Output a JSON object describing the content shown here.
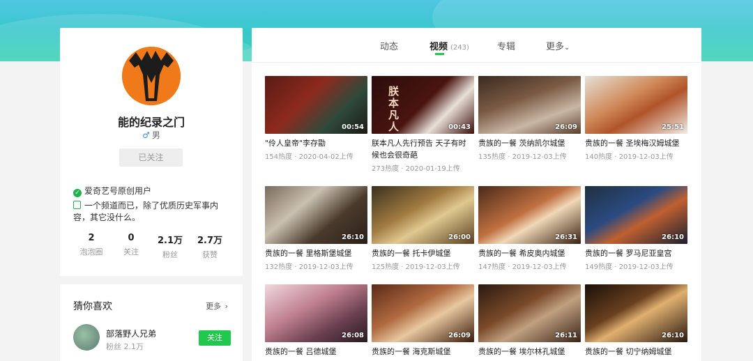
{
  "profile": {
    "name": "能的纪录之门",
    "gender_icon": "male-icon",
    "gender": "男",
    "follow_state": "已关注",
    "verified_text": "爱奇艺号原创用户",
    "intro_line1": "一个频道而已，除了优质历史军事内",
    "intro_line2": "容，其它没什么。",
    "stats": [
      {
        "value": "2",
        "label": "泡泡圈"
      },
      {
        "value": "0",
        "label": "关注"
      },
      {
        "value": "2.1万",
        "label": "粉丝"
      },
      {
        "value": "2.7万",
        "label": "获赞"
      }
    ]
  },
  "recommend": {
    "title": "猜你喜欢",
    "more": "更多",
    "user_name": "部落野人兄弟",
    "user_fans": "粉丝 2.1万",
    "follow_label": "关注"
  },
  "tabs": {
    "dynamic": "动态",
    "video": "视频",
    "video_count": "(243)",
    "album": "专辑",
    "more": "更多"
  },
  "colors": {
    "accent": "#22c84e",
    "banner": "#3ec8cf",
    "avatar_orange": "#f07a1a"
  },
  "videos": [
    {
      "title": "\"伶人皇帝\"李存勖",
      "title2": "",
      "meta": "154热度 · 2020-04-02上传",
      "duration": "00:54"
    },
    {
      "title": "朕本凡人先行预告 天子有时",
      "title2": "候也会很奇葩",
      "meta": "273热度 · 2020-01-19上传",
      "duration": "00:43"
    },
    {
      "title": "贵族的一餐 茨纳凯尔城堡",
      "title2": "",
      "meta": "135热度 · 2019-12-03上传",
      "duration": "26:09"
    },
    {
      "title": "贵族的一餐 圣埃梅汉姆城堡",
      "title2": "",
      "meta": "140热度 · 2019-12-03上传",
      "duration": "25:51"
    },
    {
      "title": "贵族的一餐 里格斯堡城堡",
      "title2": "",
      "meta": "132热度 · 2019-12-03上传",
      "duration": "26:10"
    },
    {
      "title": "贵族的一餐 托卡伊城堡",
      "title2": "",
      "meta": "125热度 · 2019-12-03上传",
      "duration": "26:00"
    },
    {
      "title": "贵族的一餐 希皮奥内城堡",
      "title2": "",
      "meta": "147热度 · 2019-12-03上传",
      "duration": "26:31"
    },
    {
      "title": "贵族的一餐 罗马尼亚皇宫",
      "title2": "",
      "meta": "149热度 · 2019-12-03上传",
      "duration": "26:10"
    },
    {
      "title": "贵族的一餐 吕德城堡",
      "title2": "",
      "meta": "",
      "duration": "26:08"
    },
    {
      "title": "贵族的一餐 海克斯城堡",
      "title2": "",
      "meta": "",
      "duration": "26:09"
    },
    {
      "title": "贵族的一餐 埃尔林孔城堡",
      "title2": "",
      "meta": "",
      "duration": "26:11"
    },
    {
      "title": "贵族的一餐 切宁纳姆城堡",
      "title2": "",
      "meta": "",
      "duration": "26:10"
    }
  ],
  "poster_text": "朕本凡人"
}
